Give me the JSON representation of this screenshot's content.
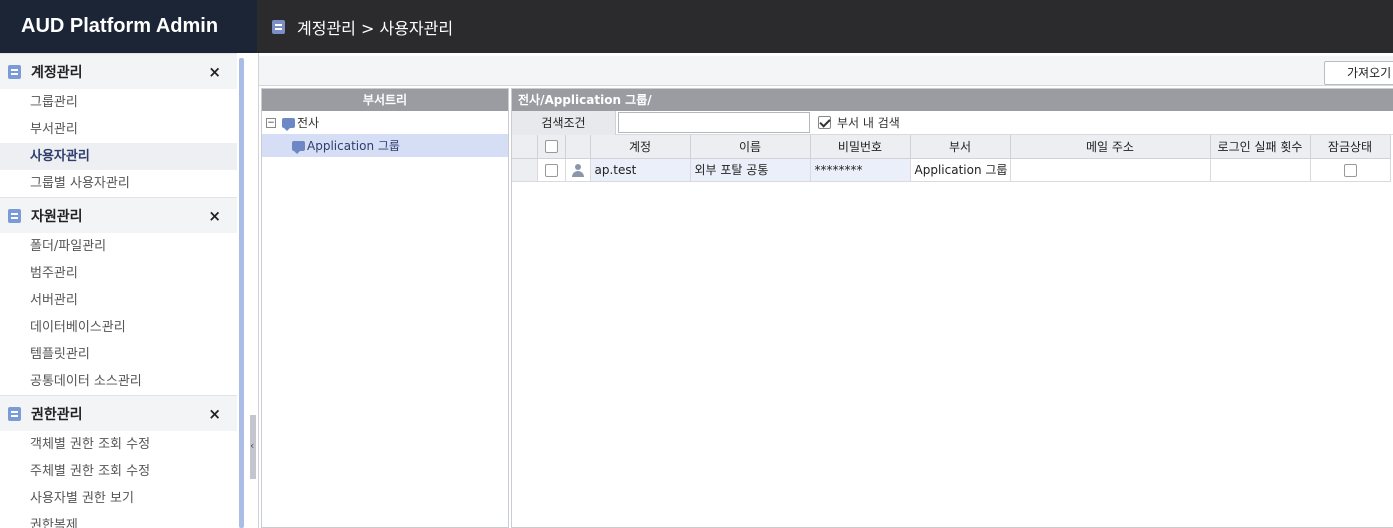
{
  "app": {
    "title": "AUD Platform Admin"
  },
  "header": {
    "breadcrumb": "계정관리 > 사용자관리"
  },
  "sidebar": {
    "sections": [
      {
        "title": "계정관리",
        "items": [
          "그룹관리",
          "부서관리",
          "사용자관리",
          "그룹별 사용자관리"
        ],
        "active_item": "사용자관리"
      },
      {
        "title": "자원관리",
        "items": [
          "폴더/파일관리",
          "범주관리",
          "서버관리",
          "데이터베이스관리",
          "템플릿관리",
          "공통데이터 소스관리"
        ]
      },
      {
        "title": "권한관리",
        "items": [
          "객체별 권한 조회 수정",
          "주체별 권한 조회 수정",
          "사용자별 권한 보기",
          "권한복제"
        ]
      }
    ],
    "close_glyph": "×",
    "collapse_glyph": "‹"
  },
  "toolbar": {
    "import_label": "가져오기"
  },
  "dept_tree": {
    "header": "부서트리",
    "root": {
      "label": "전사",
      "expander": "−"
    },
    "children": [
      {
        "label": "Application 그룹"
      }
    ]
  },
  "user_grid": {
    "path_header": "전사/Application 그룹/",
    "search": {
      "label": "검색조건",
      "value": "",
      "in_dept_label": "부서 내 검색",
      "in_dept_checked": true
    },
    "columns": [
      "계정",
      "이름",
      "비밀번호",
      "부서",
      "메일 주소",
      "로그인 실패 횟수",
      "잠금상태"
    ],
    "rows": [
      {
        "account": "ap.test",
        "name": "외부 포탈 공통",
        "password": "********",
        "dept": "Application 그룹",
        "email": "",
        "login_fail_count": "",
        "locked": false
      }
    ]
  }
}
